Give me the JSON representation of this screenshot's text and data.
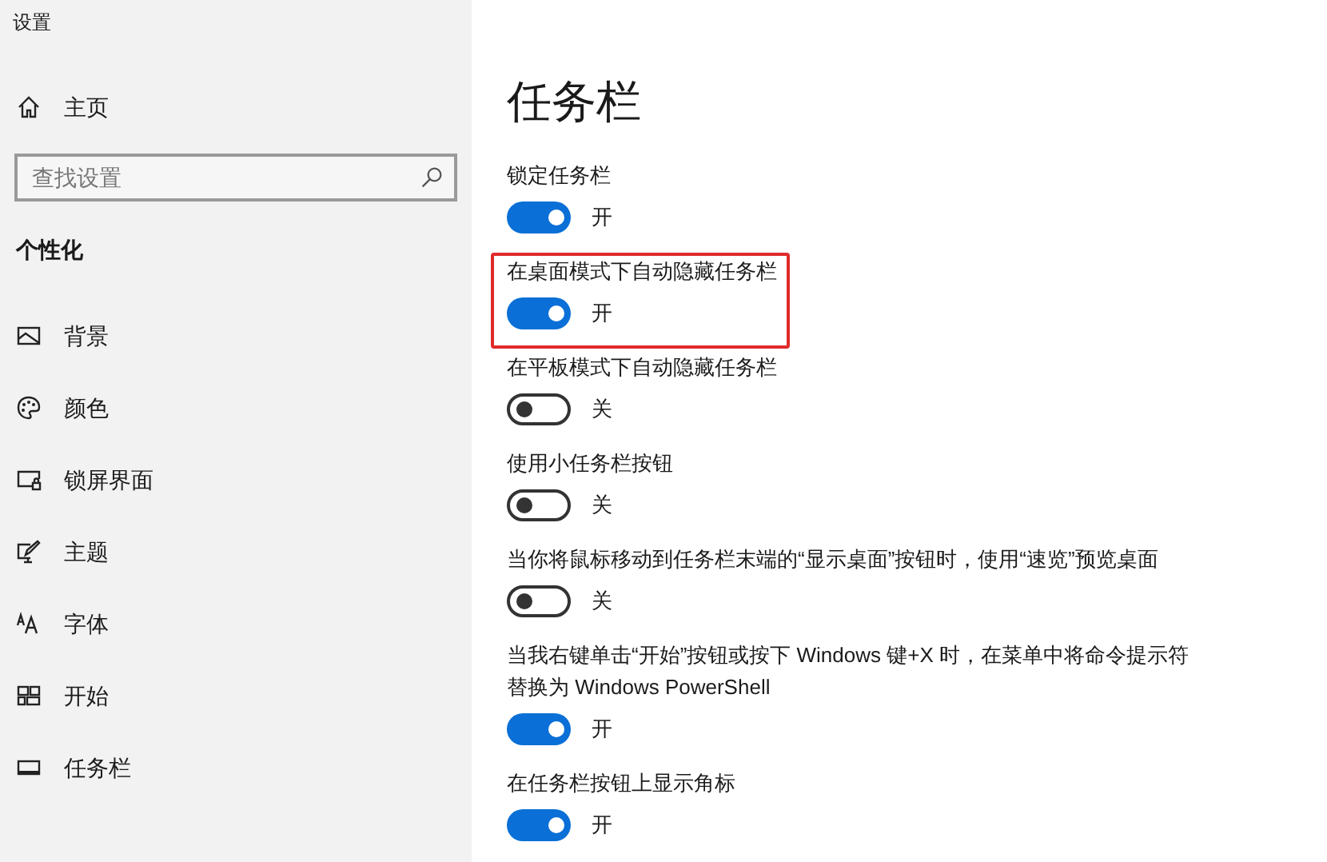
{
  "window": {
    "title": "设置"
  },
  "sidebar": {
    "home": "主页",
    "search": {
      "placeholder": "查找设置"
    },
    "section": "个性化",
    "items": [
      {
        "label": "背景",
        "kind": "picture"
      },
      {
        "label": "颜色",
        "kind": "palette"
      },
      {
        "label": "锁屏界面",
        "kind": "lockscreen"
      },
      {
        "label": "主题",
        "kind": "theme"
      },
      {
        "label": "字体",
        "kind": "font"
      },
      {
        "label": "开始",
        "kind": "start"
      },
      {
        "label": "任务栏",
        "kind": "taskbar"
      }
    ]
  },
  "page": {
    "title": "任务栏",
    "settings": [
      {
        "label": "锁定任务栏",
        "on": true,
        "state_text": "开",
        "highlighted": false
      },
      {
        "label": "在桌面模式下自动隐藏任务栏",
        "on": true,
        "state_text": "开",
        "highlighted": true
      },
      {
        "label": "在平板模式下自动隐藏任务栏",
        "on": false,
        "state_text": "关",
        "highlighted": false
      },
      {
        "label": "使用小任务栏按钮",
        "on": false,
        "state_text": "关",
        "highlighted": false
      },
      {
        "label": "当你将鼠标移动到任务栏末端的“显示桌面”按钮时，使用“速览”预览桌面",
        "on": false,
        "state_text": "关",
        "highlighted": false
      },
      {
        "label": "当我右键单击“开始”按钮或按下 Windows 键+X 时，在菜单中将命令提示符替换为 Windows PowerShell",
        "on": true,
        "state_text": "开",
        "highlighted": false
      },
      {
        "label": "在任务栏按钮上显示角标",
        "on": true,
        "state_text": "开",
        "highlighted": false
      }
    ]
  }
}
